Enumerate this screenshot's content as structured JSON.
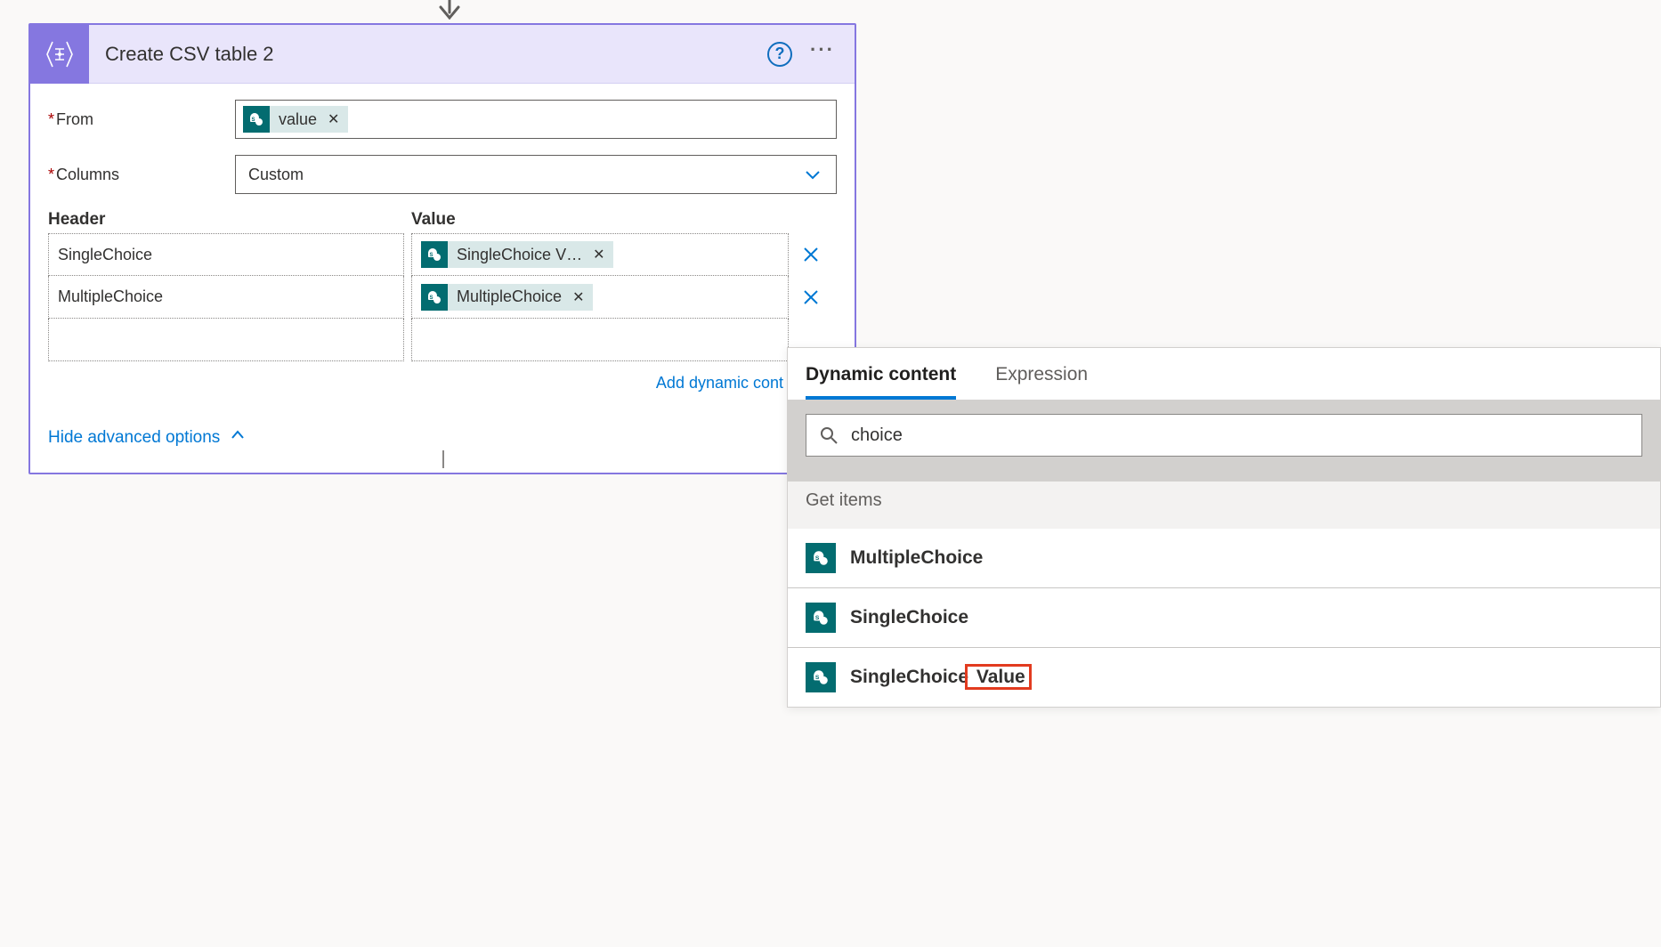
{
  "card": {
    "title": "Create CSV table 2",
    "from_label": "From",
    "from_token": "value",
    "columns_label": "Columns",
    "columns_value": "Custom",
    "header_col": "Header",
    "value_col": "Value",
    "rows": [
      {
        "header": "SingleChoice",
        "value_token": "SingleChoice V…"
      },
      {
        "header": "MultipleChoice",
        "value_token": "MultipleChoice"
      }
    ],
    "add_dynamic": "Add dynamic cont",
    "hide_advanced": "Hide advanced options"
  },
  "dyn": {
    "tab_dynamic": "Dynamic content",
    "tab_expression": "Expression",
    "search_value": "choice",
    "section": "Get items",
    "items": [
      {
        "label": "MultipleChoice"
      },
      {
        "label": "SingleChoice"
      },
      {
        "label_pre": "SingleChoice",
        "label_hl": " Value"
      }
    ]
  }
}
